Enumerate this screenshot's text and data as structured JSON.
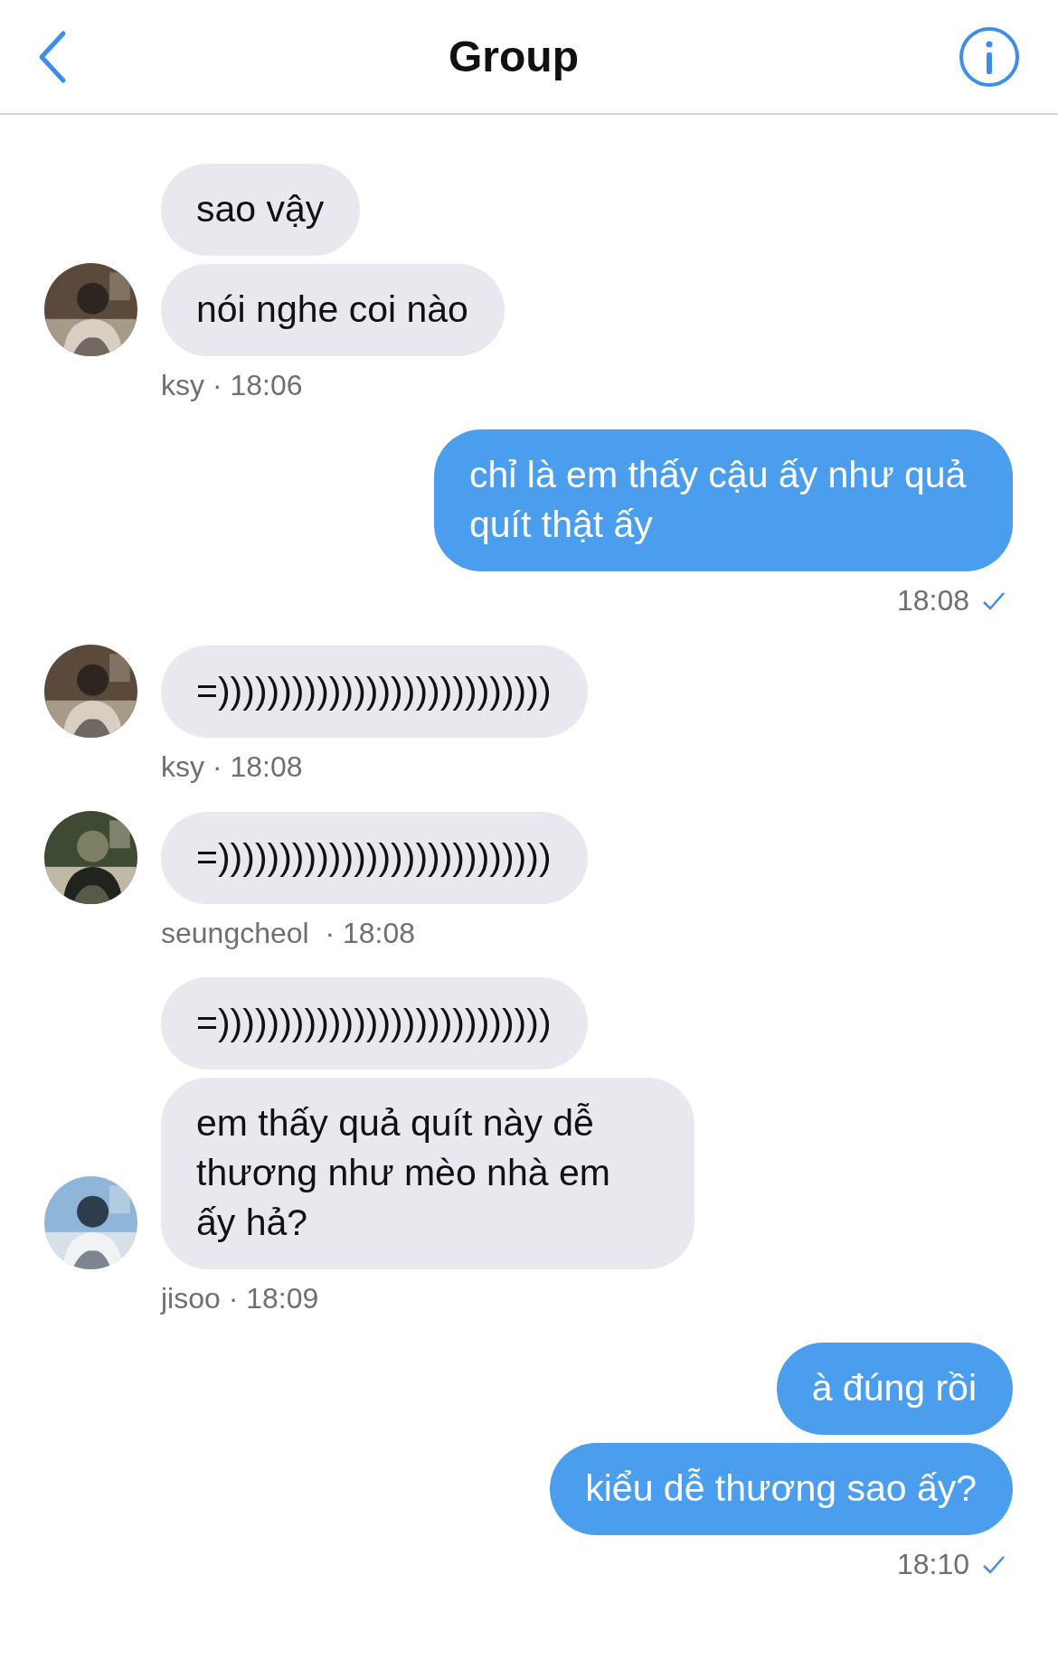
{
  "header": {
    "title": "Group"
  },
  "messages": [
    {
      "kind": "incoming",
      "bubbles": [
        "sao vậy",
        "nói nghe coi nào"
      ],
      "meta": "ksy · 18:06"
    },
    {
      "kind": "outgoing",
      "bubbles": [
        "chỉ là em thấy cậu ấy như quả quít thật ấy"
      ],
      "meta": "18:08",
      "delivered": true
    },
    {
      "kind": "incoming",
      "bubbles": [
        "=)))))))))))))))))))))))))))"
      ],
      "meta": "ksy · 18:08"
    },
    {
      "kind": "incoming",
      "bubbles": [
        "=)))))))))))))))))))))))))))"
      ],
      "meta": "seungcheol  · 18:08"
    },
    {
      "kind": "incoming",
      "bubbles": [
        "=)))))))))))))))))))))))))))",
        "em thấy quả quít này dễ thương như mèo nhà em ấy hả?"
      ],
      "meta": "jisoo · 18:09"
    },
    {
      "kind": "outgoing",
      "bubbles": [
        "à đúng rồi",
        "kiểu dễ thương sao ấy?"
      ],
      "meta": "18:10",
      "delivered": true
    }
  ]
}
